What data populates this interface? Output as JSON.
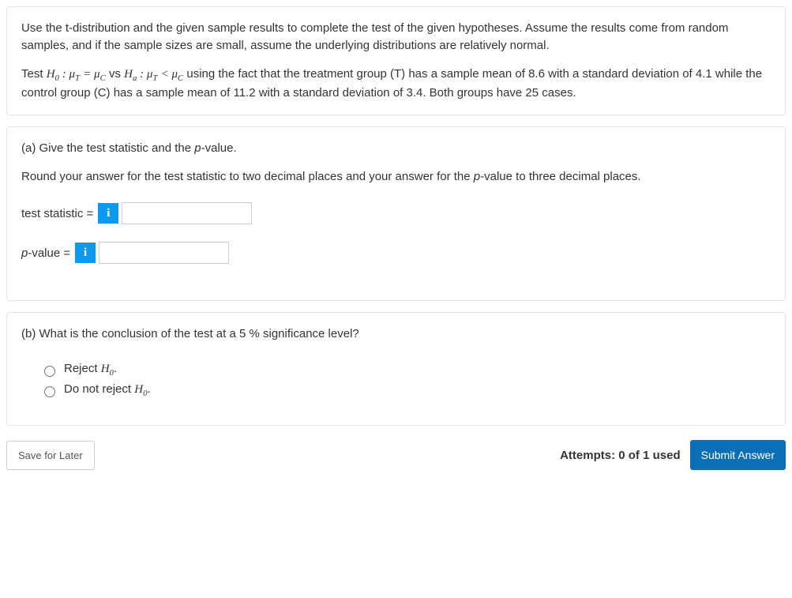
{
  "intro": {
    "para1": "Use the t-distribution and the given sample results to complete the test of the given hypotheses. Assume the results come from random samples, and if the sample sizes are small, assume the underlying distributions are relatively normal.",
    "test_prefix": "Test ",
    "vs": " vs ",
    "using": " using the fact that the treatment group (T) has a sample mean of 8.6 with a standard deviation of 4.1 while the control group (C) has a sample mean of 11.2 with a standard deviation of 3.4. Both groups have 25 cases."
  },
  "partA": {
    "prompt_prefix": "(a) Give the test statistic and the ",
    "prompt_pval": "p",
    "prompt_suffix": "-value.",
    "rounding_prefix": "Round your answer for the test statistic to two decimal places and your answer for the ",
    "rounding_pval": "p",
    "rounding_suffix": "-value to three decimal places.",
    "label_ts": "test statistic =",
    "label_pval_p": "p",
    "label_pval_rest": "-value =",
    "info_glyph": "i",
    "ts_value": "",
    "pval_value": ""
  },
  "partB": {
    "prompt_prefix": "(b) What is the conclusion of the test at a ",
    "prompt_pct": "5 %",
    "prompt_suffix": " significance level?",
    "opt1_prefix": "Reject ",
    "opt2_prefix": "Do not reject "
  },
  "hyp": {
    "H": "H",
    "zero": "0",
    "a": "a",
    "mu": "μ",
    "T": "T",
    "C": "C",
    "eq": " = ",
    "lt": " < ",
    "colon": " : ",
    "period": "."
  },
  "footer": {
    "save": "Save for Later",
    "attempts": "Attempts: 0 of 1 used",
    "submit": "Submit Answer"
  }
}
